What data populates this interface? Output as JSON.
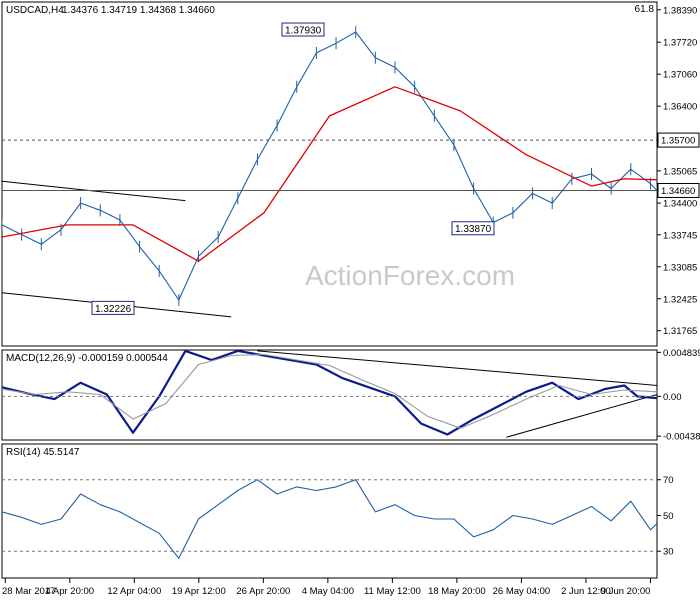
{
  "chart_data": [
    {
      "type": "line",
      "panel": "price",
      "title": "USDCAD,H4",
      "ohlc_header": "1.34376 1.34719 1.34368 1.34660",
      "corner_value": "61.8",
      "watermark": "ActionForex.com",
      "ylim": [
        1.3145,
        1.3855
      ],
      "y_ticks": [
        "1.38390",
        "1.37720",
        "1.37060",
        "1.36400",
        "1.35065",
        "1.34400",
        "1.33745",
        "1.33085",
        "1.32425",
        "1.31765"
      ],
      "y_tick_values": [
        1.3839,
        1.3772,
        1.3706,
        1.364,
        1.35065,
        1.344,
        1.33745,
        1.33085,
        1.32425,
        1.31765
      ],
      "boxed_ticks": [
        {
          "label": "1.35700",
          "value": 1.357
        },
        {
          "label": "1.34660",
          "value": 1.3466
        }
      ],
      "horizontal_levels": [
        {
          "value": 1.357,
          "style": "dashed"
        },
        {
          "value": 1.3466,
          "style": "solid"
        }
      ],
      "annotations": [
        {
          "text": "1.37930",
          "x": "4 May 2017 04:00",
          "y": 1.3793
        },
        {
          "text": "1.32226",
          "x": "12 Apr 2017 04:00",
          "y": 1.32226
        },
        {
          "text": "1.33870",
          "x": "23 May 2017 12:00",
          "y": 1.3387
        }
      ],
      "x_ticks": [
        "28 Mar 2017",
        "4 Apr 20:00",
        "12 Apr 04:00",
        "19 Apr 12:00",
        "26 Apr 20:00",
        "4 May 04:00",
        "11 May 12:00",
        "18 May 20:00",
        "26 May 04:00",
        "2 Jun 12:00",
        "9 Jun 20:00"
      ],
      "series": [
        {
          "name": "",
          "color": "#1f5fa8",
          "kind": "price",
          "x": [
            0,
            3,
            6,
            9,
            12,
            15,
            18,
            21,
            24,
            27,
            30,
            33,
            36,
            39,
            42,
            45,
            48,
            51,
            54,
            57,
            60,
            63,
            66,
            69,
            72,
            75,
            78,
            81,
            84,
            87,
            90,
            93,
            96,
            99,
            100
          ],
          "values": [
            1.3395,
            1.3375,
            1.3355,
            1.3385,
            1.344,
            1.3425,
            1.3405,
            1.335,
            1.33,
            1.324,
            1.333,
            1.337,
            1.345,
            1.353,
            1.36,
            1.368,
            1.375,
            1.377,
            1.3793,
            1.374,
            1.372,
            1.368,
            1.362,
            1.356,
            1.347,
            1.34,
            1.342,
            1.346,
            1.344,
            1.349,
            1.35,
            1.347,
            1.351,
            1.348,
            1.3466
          ]
        },
        {
          "name": "",
          "color": "#e00000",
          "kind": "moving-average",
          "x": [
            0,
            10,
            20,
            30,
            40,
            50,
            60,
            70,
            80,
            90,
            95,
            100
          ],
          "values": [
            1.337,
            1.3395,
            1.3395,
            1.332,
            1.342,
            1.362,
            1.368,
            1.363,
            1.354,
            1.3475,
            1.349,
            1.3488
          ]
        }
      ],
      "trendlines": [
        {
          "from": {
            "x": 0,
            "y": 1.3485
          },
          "to": {
            "x": 28,
            "y": 1.3445
          }
        },
        {
          "from": {
            "x": 0,
            "y": 1.3255
          },
          "to": {
            "x": 35,
            "y": 1.3205
          }
        }
      ]
    },
    {
      "type": "line",
      "panel": "macd",
      "title": "MACD(12,26,9) -0.000159 0.000544",
      "ylim": [
        -0.0048,
        0.0051
      ],
      "y_ticks": [
        "0.004839",
        "0.00",
        "-0.004381"
      ],
      "y_tick_values": [
        0.004839,
        0.0,
        -0.004381
      ],
      "series": [
        {
          "name": "",
          "color": "#0b1a8c",
          "kind": "macd",
          "x": [
            0,
            4,
            8,
            12,
            16,
            20,
            24,
            28,
            32,
            36,
            40,
            44,
            48,
            52,
            56,
            60,
            64,
            68,
            72,
            76,
            80,
            84,
            88,
            92,
            95,
            97,
            100
          ],
          "values": [
            0.001,
            0.0003,
            -0.0003,
            0.0015,
            0.0002,
            -0.004,
            0.0,
            0.005,
            0.004,
            0.005,
            0.0045,
            0.004,
            0.0035,
            0.002,
            0.001,
            0.0,
            -0.003,
            -0.0042,
            -0.0025,
            -0.001,
            0.0005,
            0.0015,
            -0.0003,
            0.0008,
            0.0012,
            0.0,
            -0.0002
          ]
        },
        {
          "name": "",
          "color": "#999999",
          "kind": "signal",
          "x": [
            0,
            5,
            10,
            15,
            20,
            25,
            30,
            35,
            40,
            45,
            50,
            55,
            60,
            65,
            70,
            75,
            80,
            85,
            90,
            95,
            100
          ],
          "values": [
            0.0008,
            0.0002,
            0.0005,
            0.0002,
            -0.0025,
            -0.0008,
            0.0035,
            0.0045,
            0.0046,
            0.004,
            0.0034,
            0.0018,
            0.0003,
            -0.0022,
            -0.0035,
            -0.002,
            -0.0003,
            0.0012,
            0.0002,
            0.0007,
            0.0005
          ]
        }
      ],
      "trendlines": [
        {
          "from": {
            "x": 39,
            "y": 0.005
          },
          "to": {
            "x": 100,
            "y": 0.0012
          }
        },
        {
          "from": {
            "x": 77,
            "y": -0.0045
          },
          "to": {
            "x": 100,
            "y": 0.0002
          }
        }
      ]
    },
    {
      "type": "line",
      "panel": "rsi",
      "title": "RSI(14) 45.5147",
      "ylim": [
        15,
        90
      ],
      "y_ticks": [
        "70",
        "50",
        "30"
      ],
      "y_tick_values": [
        70,
        50,
        30
      ],
      "reference_levels": [
        70,
        30
      ],
      "series": [
        {
          "name": "",
          "color": "#1f5fa8",
          "kind": "rsi",
          "x": [
            0,
            3,
            6,
            9,
            12,
            15,
            18,
            21,
            24,
            27,
            30,
            33,
            36,
            39,
            42,
            45,
            48,
            51,
            54,
            57,
            60,
            63,
            66,
            69,
            72,
            75,
            78,
            81,
            84,
            87,
            90,
            93,
            96,
            99,
            100
          ],
          "values": [
            52,
            49,
            45,
            48,
            62,
            56,
            52,
            46,
            40,
            26,
            48,
            56,
            64,
            70,
            62,
            66,
            64,
            66,
            70,
            52,
            56,
            50,
            48,
            48,
            38,
            42,
            50,
            48,
            45,
            50,
            55,
            47,
            58,
            42,
            45.5
          ]
        }
      ]
    }
  ]
}
